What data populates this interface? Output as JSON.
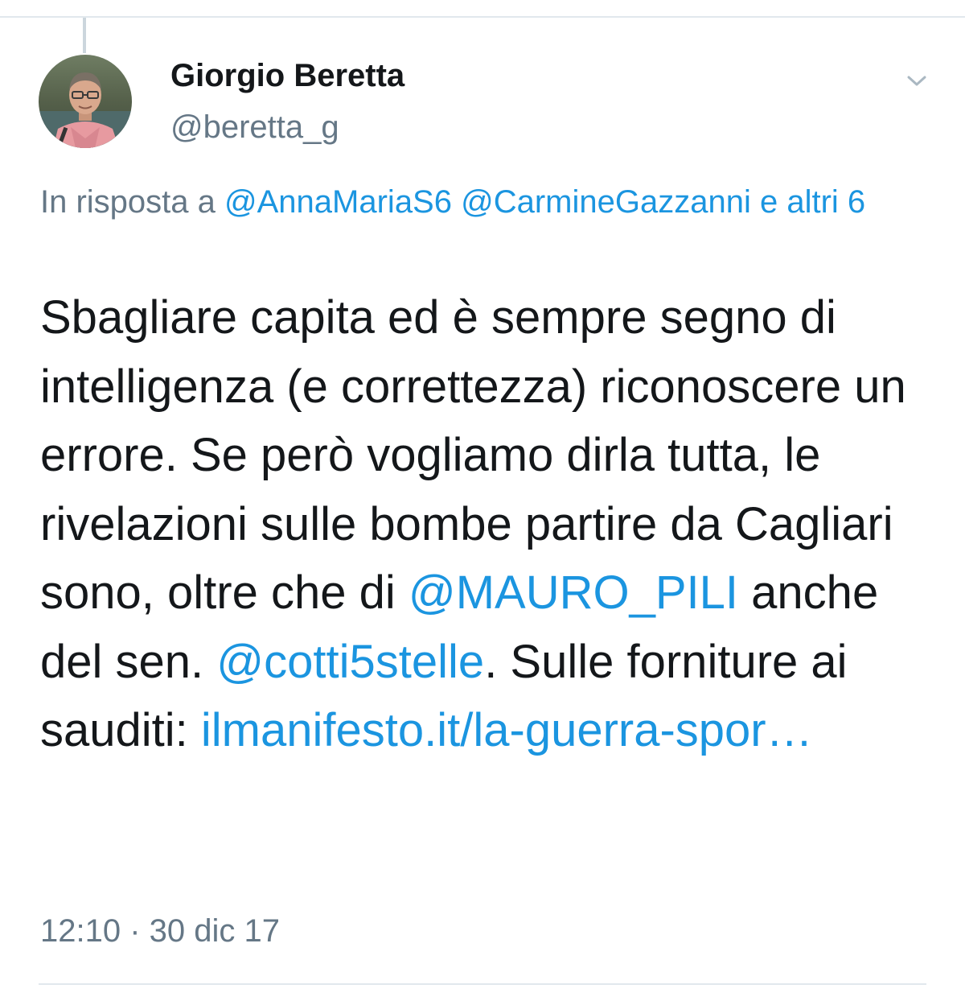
{
  "author": {
    "name": "Giorgio Beretta",
    "handle": "@beretta_g"
  },
  "icons": {
    "avatar": "profile-photo",
    "menu": "chevron-down-icon"
  },
  "reply": {
    "prefix": "In risposta a",
    "mention_1": "@AnnaMariaS6",
    "mention_2": "@CarmineGazzanni",
    "others": "e altri 6"
  },
  "tweet": {
    "text_1": "Sbagliare capita ed è sempre segno di intelligenza (e correttezza) riconoscere un errore. Se però vogliamo dirla tutta, le rivelazioni sulle bombe partire da Cagliari sono, oltre che di",
    "mention_1": "@MAURO_PILI",
    "text_2": "anche del sen.",
    "mention_2": "@cotti5stelle",
    "text_3": ". Sulle forniture ai sauditi:",
    "link": "ilmanifesto.it/la-guerra-spor…"
  },
  "timestamp": "12:10 · 30 dic 17",
  "colors": {
    "link": "#1b95e0",
    "secondary_text": "#657786",
    "primary_text": "#14171a",
    "divider": "#e1e8ed"
  }
}
